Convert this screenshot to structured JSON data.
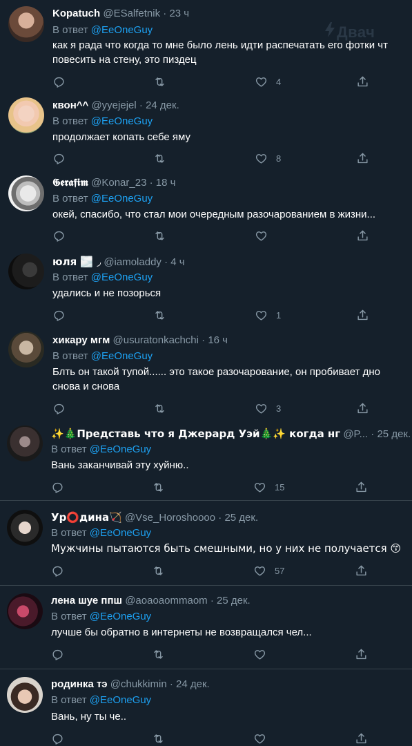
{
  "watermark": "Двач",
  "reply_prefix": "В ответ ",
  "tweets": [
    {
      "name": "Kopatuch",
      "handle": "@ESalfetnik",
      "time": "23 ч",
      "reply_to": "@EeOneGuy",
      "lines": [
        "как я рада что когда то мне было лень идти распечатать его фотки чт",
        "повесить на стену, это пиздец"
      ],
      "likes": "4"
    },
    {
      "name": "квон^^",
      "handle": "@yyejejel",
      "time": "24 дек.",
      "reply_to": "@EeOneGuy",
      "lines": [
        "продолжает копать себе яму"
      ],
      "likes": "8"
    },
    {
      "name": "𝕲𝖊𝖗𝖆𝖋𝖎𝖒",
      "handle": "@Konar_23",
      "time": "18 ч",
      "reply_to": "",
      "lines": [
        "окей,  спасибо,  что стал мои очередным разочарованием в жизни..."
      ],
      "likes": ""
    },
    {
      "name": "юля 🌫️ ◞",
      "handle": "@iamoladdy",
      "time": "4 ч",
      "reply_to": "@EeOneGuy",
      "lines": [
        "удались и не позорься"
      ],
      "likes": "1"
    },
    {
      "name": "хикару мгм",
      "handle": "@usuratonkachchi",
      "time": "16 ч",
      "reply_to": "@EeOneGuy",
      "lines": [
        "Блть он такой тупой...... это такое разочарование, он пробивает дно",
        "снова и снова"
      ],
      "likes": "3"
    },
    {
      "name": "✨🎄Представь что я Джерард Уэй🎄✨ когда нг",
      "handle": "@P...",
      "time": "25 дек.",
      "reply_to": "@EeOneGuy",
      "lines": [
        "Вань заканчивай эту хуйню.."
      ],
      "likes": "15"
    },
    {
      "name": "Ур⭕дина🏹",
      "handle": "@Vse_Horoshoooo",
      "time": "25 дек.",
      "reply_to": "@EeOneGuy",
      "lines": [
        "Мужчины пытаются быть смешными, но у них не получается 😙"
      ],
      "likes": "57"
    },
    {
      "name": "лена шуе ппш",
      "handle": "@aoaoaommaom",
      "time": "25 дек.",
      "reply_to": "@EeOneGuy",
      "lines": [
        "лучше бы обратно в интернеты не возвращался чел..."
      ],
      "likes": ""
    },
    {
      "name": "родинка тэ",
      "handle": "@chukkimin",
      "time": "24 дек.",
      "reply_to": "@EeOneGuy",
      "lines": [
        "Вань, ну ты че.."
      ],
      "likes": ""
    }
  ],
  "colors": {
    "background": "#15202b",
    "divider": "#38444d",
    "secondary_text": "#8899a6",
    "accent": "#1da1f2"
  },
  "icons": [
    "reply-icon",
    "retweet-icon",
    "like-icon",
    "share-icon"
  ]
}
